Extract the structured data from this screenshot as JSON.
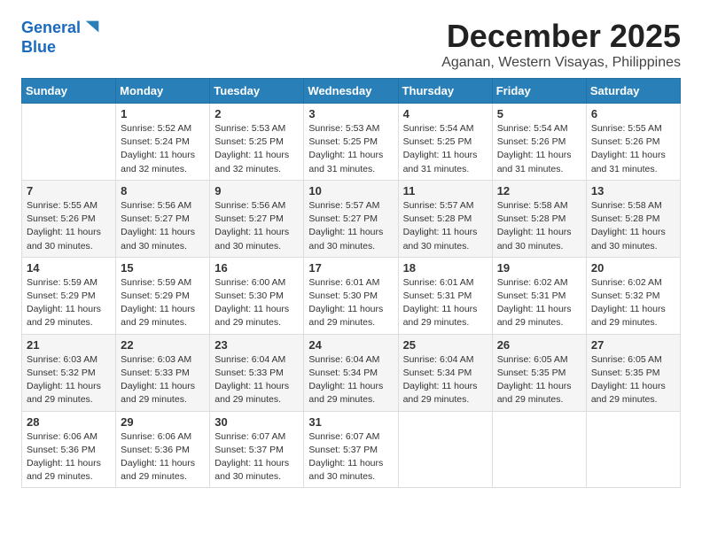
{
  "logo": {
    "line1": "General",
    "line2": "Blue"
  },
  "title": "December 2025",
  "location": "Aganan, Western Visayas, Philippines",
  "weekdays": [
    "Sunday",
    "Monday",
    "Tuesday",
    "Wednesday",
    "Thursday",
    "Friday",
    "Saturday"
  ],
  "weeks": [
    [
      {
        "day": "",
        "info": ""
      },
      {
        "day": "1",
        "info": "Sunrise: 5:52 AM\nSunset: 5:24 PM\nDaylight: 11 hours\nand 32 minutes."
      },
      {
        "day": "2",
        "info": "Sunrise: 5:53 AM\nSunset: 5:25 PM\nDaylight: 11 hours\nand 32 minutes."
      },
      {
        "day": "3",
        "info": "Sunrise: 5:53 AM\nSunset: 5:25 PM\nDaylight: 11 hours\nand 31 minutes."
      },
      {
        "day": "4",
        "info": "Sunrise: 5:54 AM\nSunset: 5:25 PM\nDaylight: 11 hours\nand 31 minutes."
      },
      {
        "day": "5",
        "info": "Sunrise: 5:54 AM\nSunset: 5:26 PM\nDaylight: 11 hours\nand 31 minutes."
      },
      {
        "day": "6",
        "info": "Sunrise: 5:55 AM\nSunset: 5:26 PM\nDaylight: 11 hours\nand 31 minutes."
      }
    ],
    [
      {
        "day": "7",
        "info": "Sunrise: 5:55 AM\nSunset: 5:26 PM\nDaylight: 11 hours\nand 30 minutes."
      },
      {
        "day": "8",
        "info": "Sunrise: 5:56 AM\nSunset: 5:27 PM\nDaylight: 11 hours\nand 30 minutes."
      },
      {
        "day": "9",
        "info": "Sunrise: 5:56 AM\nSunset: 5:27 PM\nDaylight: 11 hours\nand 30 minutes."
      },
      {
        "day": "10",
        "info": "Sunrise: 5:57 AM\nSunset: 5:27 PM\nDaylight: 11 hours\nand 30 minutes."
      },
      {
        "day": "11",
        "info": "Sunrise: 5:57 AM\nSunset: 5:28 PM\nDaylight: 11 hours\nand 30 minutes."
      },
      {
        "day": "12",
        "info": "Sunrise: 5:58 AM\nSunset: 5:28 PM\nDaylight: 11 hours\nand 30 minutes."
      },
      {
        "day": "13",
        "info": "Sunrise: 5:58 AM\nSunset: 5:28 PM\nDaylight: 11 hours\nand 30 minutes."
      }
    ],
    [
      {
        "day": "14",
        "info": "Sunrise: 5:59 AM\nSunset: 5:29 PM\nDaylight: 11 hours\nand 29 minutes."
      },
      {
        "day": "15",
        "info": "Sunrise: 5:59 AM\nSunset: 5:29 PM\nDaylight: 11 hours\nand 29 minutes."
      },
      {
        "day": "16",
        "info": "Sunrise: 6:00 AM\nSunset: 5:30 PM\nDaylight: 11 hours\nand 29 minutes."
      },
      {
        "day": "17",
        "info": "Sunrise: 6:01 AM\nSunset: 5:30 PM\nDaylight: 11 hours\nand 29 minutes."
      },
      {
        "day": "18",
        "info": "Sunrise: 6:01 AM\nSunset: 5:31 PM\nDaylight: 11 hours\nand 29 minutes."
      },
      {
        "day": "19",
        "info": "Sunrise: 6:02 AM\nSunset: 5:31 PM\nDaylight: 11 hours\nand 29 minutes."
      },
      {
        "day": "20",
        "info": "Sunrise: 6:02 AM\nSunset: 5:32 PM\nDaylight: 11 hours\nand 29 minutes."
      }
    ],
    [
      {
        "day": "21",
        "info": "Sunrise: 6:03 AM\nSunset: 5:32 PM\nDaylight: 11 hours\nand 29 minutes."
      },
      {
        "day": "22",
        "info": "Sunrise: 6:03 AM\nSunset: 5:33 PM\nDaylight: 11 hours\nand 29 minutes."
      },
      {
        "day": "23",
        "info": "Sunrise: 6:04 AM\nSunset: 5:33 PM\nDaylight: 11 hours\nand 29 minutes."
      },
      {
        "day": "24",
        "info": "Sunrise: 6:04 AM\nSunset: 5:34 PM\nDaylight: 11 hours\nand 29 minutes."
      },
      {
        "day": "25",
        "info": "Sunrise: 6:04 AM\nSunset: 5:34 PM\nDaylight: 11 hours\nand 29 minutes."
      },
      {
        "day": "26",
        "info": "Sunrise: 6:05 AM\nSunset: 5:35 PM\nDaylight: 11 hours\nand 29 minutes."
      },
      {
        "day": "27",
        "info": "Sunrise: 6:05 AM\nSunset: 5:35 PM\nDaylight: 11 hours\nand 29 minutes."
      }
    ],
    [
      {
        "day": "28",
        "info": "Sunrise: 6:06 AM\nSunset: 5:36 PM\nDaylight: 11 hours\nand 29 minutes."
      },
      {
        "day": "29",
        "info": "Sunrise: 6:06 AM\nSunset: 5:36 PM\nDaylight: 11 hours\nand 29 minutes."
      },
      {
        "day": "30",
        "info": "Sunrise: 6:07 AM\nSunset: 5:37 PM\nDaylight: 11 hours\nand 30 minutes."
      },
      {
        "day": "31",
        "info": "Sunrise: 6:07 AM\nSunset: 5:37 PM\nDaylight: 11 hours\nand 30 minutes."
      },
      {
        "day": "",
        "info": ""
      },
      {
        "day": "",
        "info": ""
      },
      {
        "day": "",
        "info": ""
      }
    ]
  ]
}
